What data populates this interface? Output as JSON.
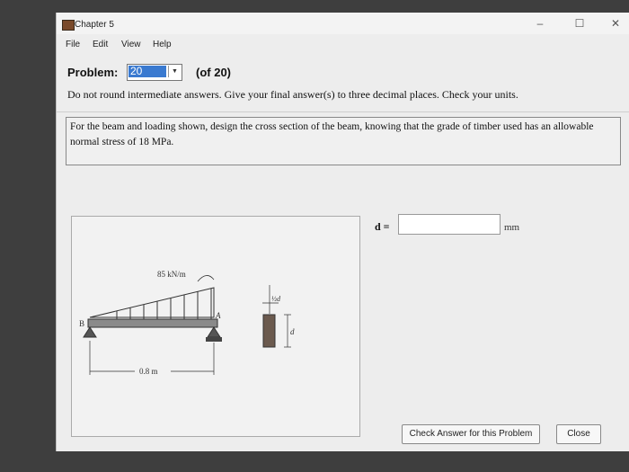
{
  "window": {
    "title": "Chapter 5"
  },
  "menu": [
    "File",
    "Edit",
    "View",
    "Help"
  ],
  "problem": {
    "label": "Problem:",
    "selected": "20",
    "of_text": "(of 20)"
  },
  "instructions": "Do not round intermediate answers.  Give your final answer(s) to three decimal places.  Check your units.",
  "prompt": "For the beam and loading shown, design the cross section of the beam, knowing that the grade of timber used has an allowable normal stress of 18 MPa.",
  "figure": {
    "load_label": "85 kN/m",
    "length_label": "0.8 m",
    "label_B": "B",
    "label_A": "A",
    "half_d": "½d",
    "d_label": "d"
  },
  "answer": {
    "label": "d =",
    "value": "",
    "unit": "mm"
  },
  "buttons": {
    "check": "Check Answer for this Problem",
    "close": "Close"
  },
  "icons": {
    "minimize": "minimize-icon",
    "maximize": "maximize-icon",
    "close": "close-icon"
  }
}
